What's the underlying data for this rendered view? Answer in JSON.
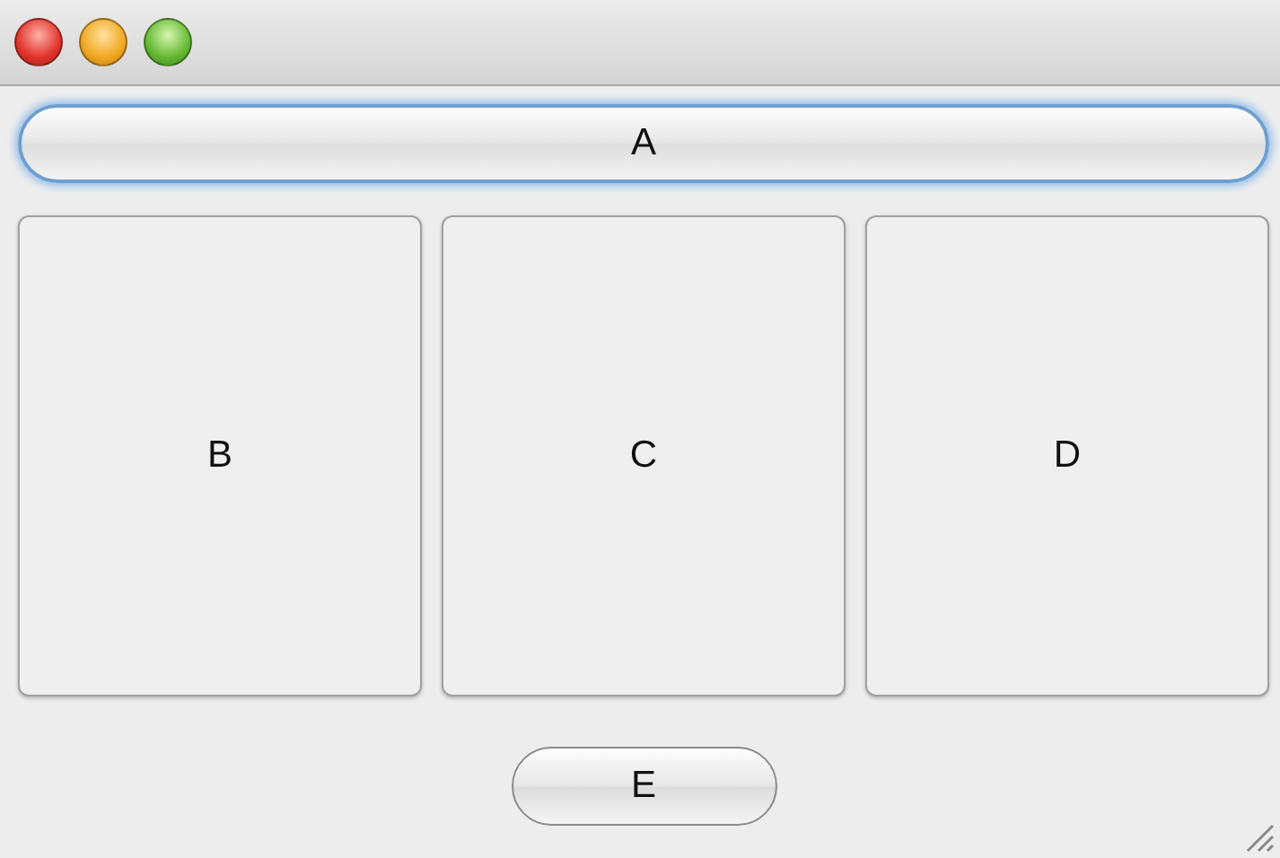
{
  "top_button": {
    "label": "A",
    "focused": true
  },
  "panels": [
    {
      "label": "B",
      "focused": false
    },
    {
      "label": "C",
      "focused": false
    },
    {
      "label": "D",
      "focused": false
    }
  ],
  "bottom_button": {
    "label": "E",
    "focused": false
  }
}
